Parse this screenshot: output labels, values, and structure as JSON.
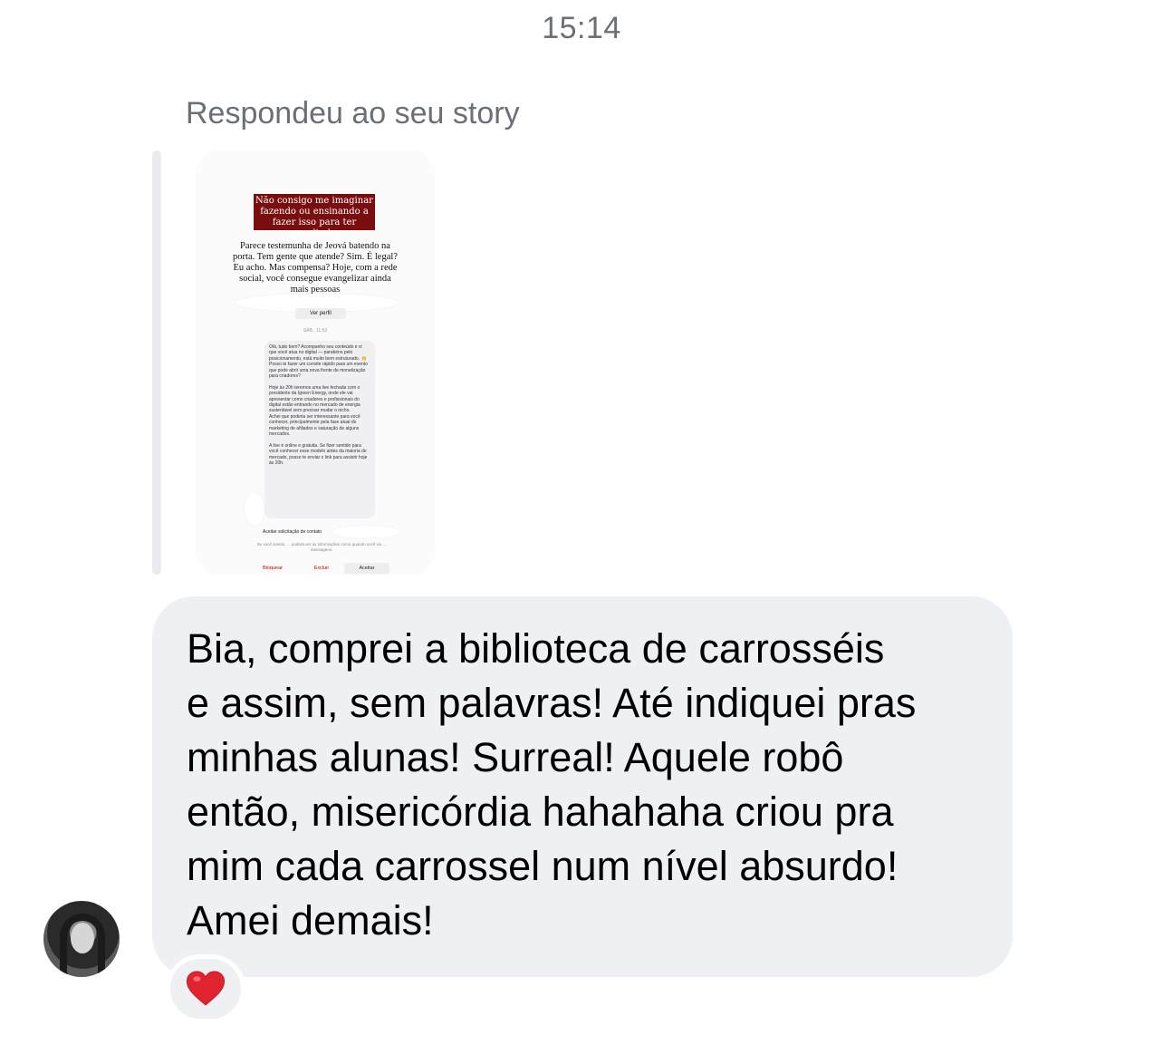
{
  "header": {
    "time": "15:14"
  },
  "reply": {
    "label": "Respondeu ao seu story"
  },
  "story": {
    "title": "Não consigo me imaginar fazendo ou ensinando a fazer isso para ter resultado",
    "body": "Parece testemunha de Jeová batendo na porta. Tem gente que atende? Sim. É legal? Eu acho. Mas compensa? Hoje, com a rede social, você consegue evangelizar ainda mais pessoas",
    "profile_button": "Ver perfil",
    "time": "SÁB., 11:53",
    "dm_text": "Olá, tudo bem? Acompanho seu conteúdo e vi que você atua no digital — parabéns pelo posicionamento, está muito bem estruturado. 👏\nPosso te fazer um convite rápido para um evento que pode abrir uma nova frente de monetização para criadores?\n\nHoje às 20h teremos uma live fechada com o presidente da Igreen Energy, onde ele vai apresentar como criadores e profissionais do digital estão entrando no mercado de energia sustentável sem precisar mudar o nicho.\nAchei que poderia ser interessante para você conhecer, principalmente pela fase atual do marketing de afiliados e saturação de alguns mercados.\n\nA live é online e gratuita. Se fizer sentido para você conhecer esse modelo antes da maioria do mercado, posso te enviar o link para assistir hoje às 20h.",
    "accept_label": "Aceitar solicitação de contato",
    "info": "Se você aceitar, ... poderá ver as informações como quando você viu ... mensagens.",
    "buttons": {
      "block": "Bloquear",
      "delete": "Excluir",
      "accept": "Aceitar"
    }
  },
  "message": {
    "text": "Bia, comprei a biblioteca de carrosséis\ne assim, sem palavras! Até indiquei pras\nminhas alunas! Surreal! Aquele robô\nentão, misericórdia hahahaha criou pra\nmim cada carrossel num nível absurdo!\nAmei demais!"
  },
  "reaction": {
    "emoji_icon": "heart-icon",
    "color": "#e0242f"
  },
  "colors": {
    "bubble": "#eef0f3",
    "meta_text": "#6b6f76",
    "story_title_bg": "#7a0d0d"
  }
}
